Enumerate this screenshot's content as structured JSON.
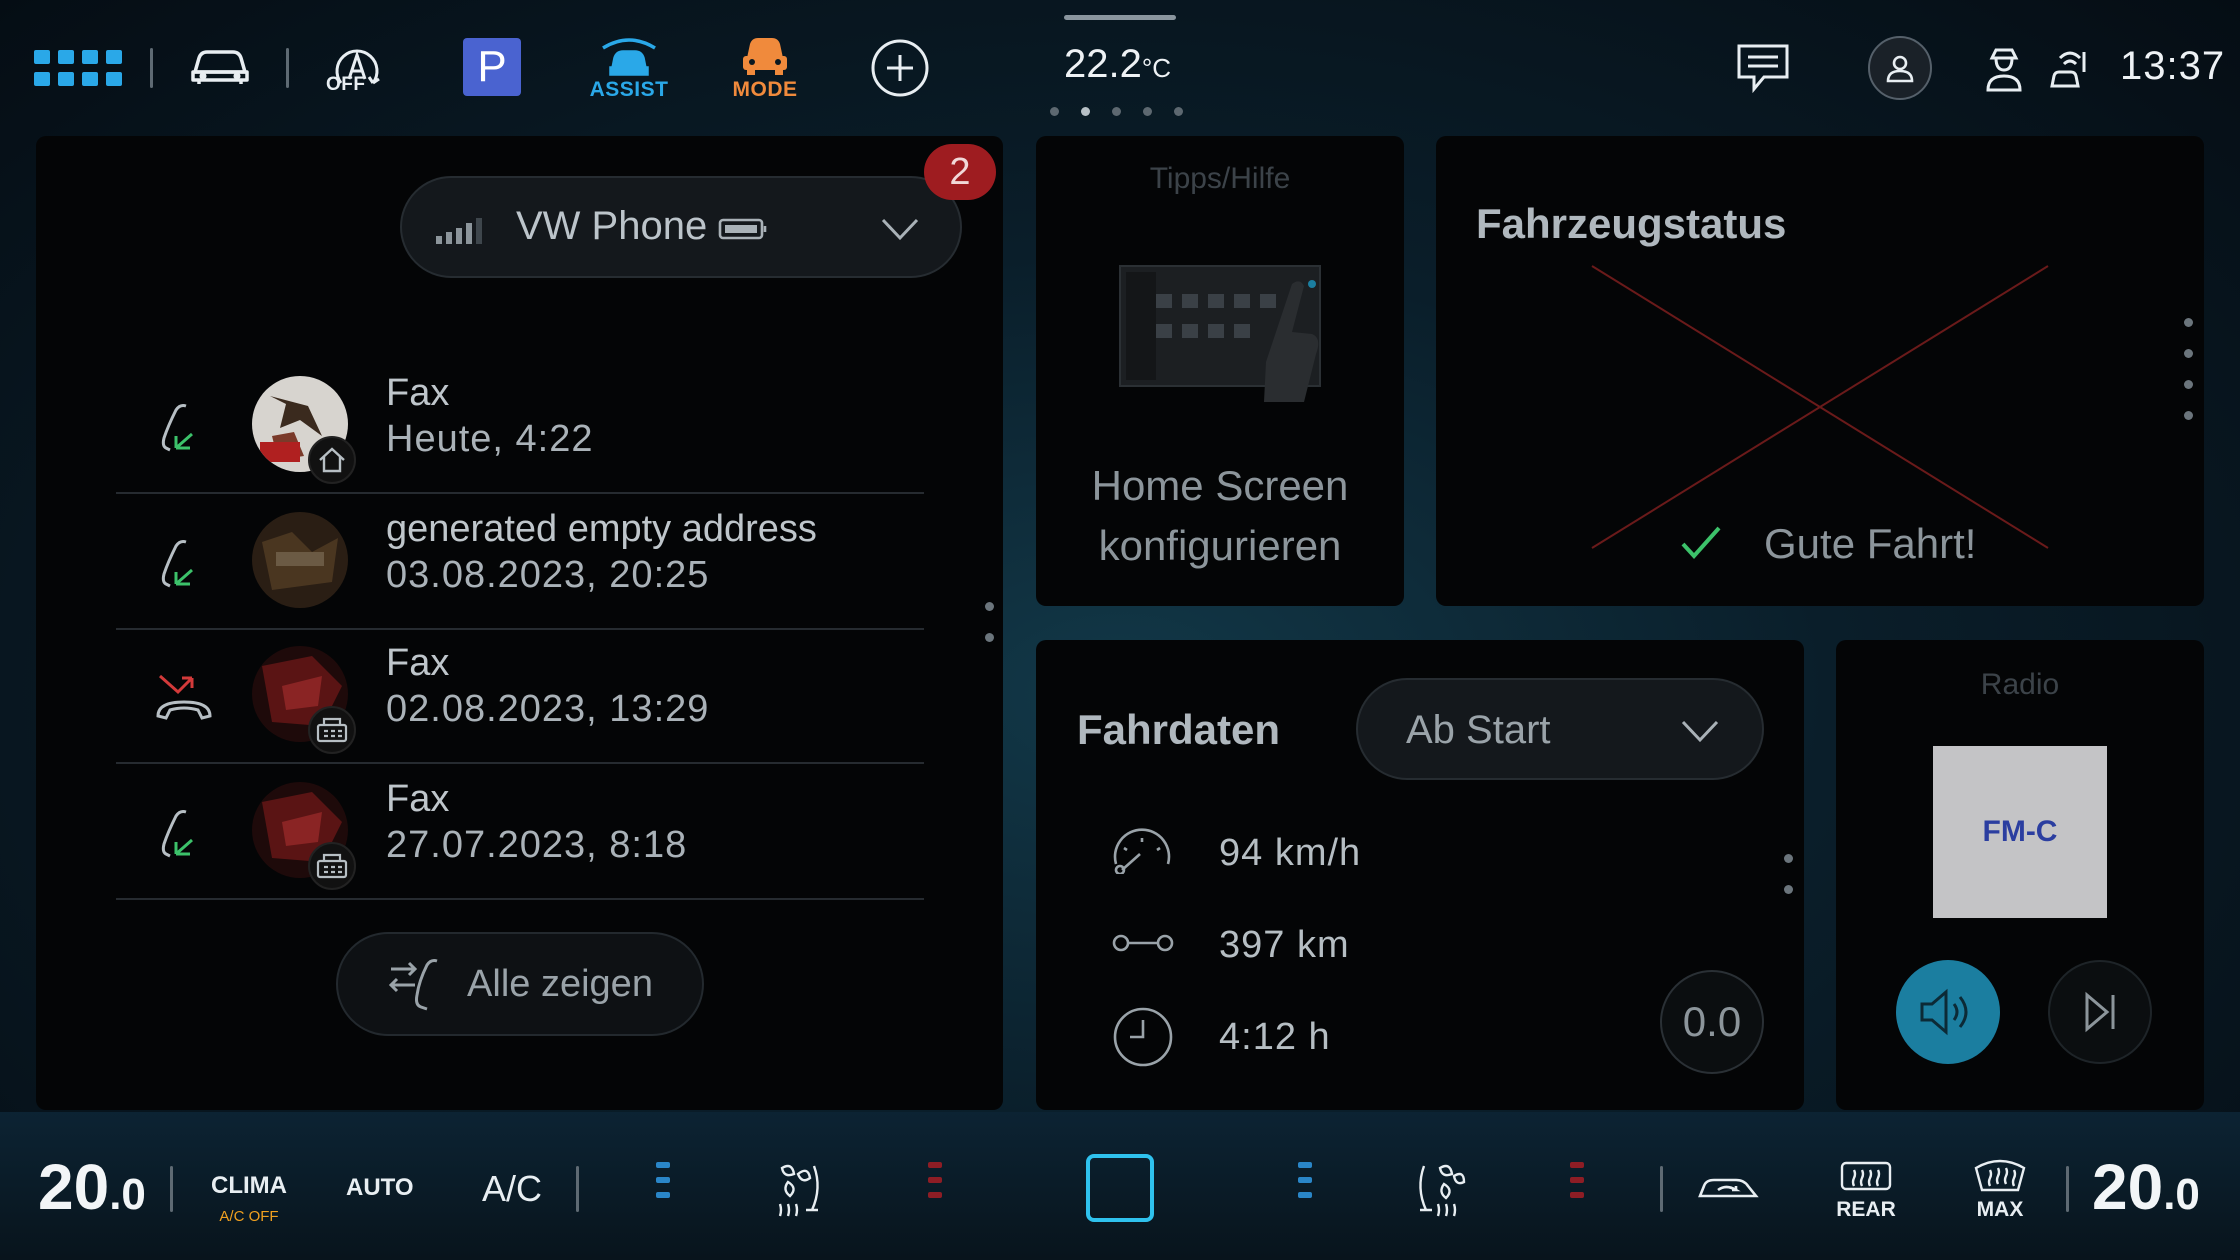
{
  "topbar": {
    "time": "13:37",
    "outside_temp": "22.2",
    "outside_temp_unit": "°C",
    "auto_hold_caption": "OFF",
    "parking_label": "P",
    "assist_label": "ASSIST",
    "mode_label": "MODE",
    "colors": {
      "accent": "#2aa8e8",
      "assist": "#2aa8e8",
      "mode": "#f08a3c",
      "parking": "#4a63d0"
    },
    "icons": [
      "apps-grid-icon",
      "car-icon",
      "auto-hold-icon",
      "parking-icon",
      "assist-icon",
      "mode-icon",
      "add-icon",
      "message-icon",
      "profile-icon",
      "driver-icon",
      "connectivity-icon"
    ]
  },
  "phone": {
    "device_name": "VW Phone",
    "badge_count": "2",
    "calls": [
      {
        "name": "Fax",
        "time": "Heute, 4:22",
        "direction": "incoming",
        "sub_icon": "home-icon"
      },
      {
        "name": "generated empty address",
        "time": "03.08.2023, 20:25",
        "direction": "incoming",
        "sub_icon": ""
      },
      {
        "name": "Fax",
        "time": "02.08.2023, 13:29",
        "direction": "missed",
        "sub_icon": "fax-icon"
      },
      {
        "name": "Fax",
        "time": "27.07.2023, 8:18",
        "direction": "incoming",
        "sub_icon": "fax-icon"
      }
    ],
    "show_all_label": "Alle zeigen"
  },
  "tips": {
    "title": "Tipps/Hilfe",
    "text_line1": "Home Screen",
    "text_line2": "konfigurieren"
  },
  "status": {
    "title": "Fahrzeugstatus",
    "message": "Gute Fahrt!"
  },
  "drive": {
    "title": "Fahrdaten",
    "period": "Ab Start",
    "speed": "94 km/h",
    "distance": "397 km",
    "duration": "4:12 h",
    "reset_value": "0.0"
  },
  "radio": {
    "title": "Radio",
    "station": "FM-C"
  },
  "climate": {
    "left_temp_int": "20",
    "left_temp_dec": ".0",
    "right_temp_int": "20",
    "right_temp_dec": ".0",
    "clima_label": "CLIMA",
    "ac_off_label": "A/C OFF",
    "auto_label": "AUTO",
    "ac_label": "A/C",
    "rear_label": "REAR",
    "max_label": "MAX",
    "colors": {
      "cool": "#2a86c8",
      "heat": "#8e1d25",
      "ac_off": "#f0a020",
      "active": "#2fc2ee"
    }
  }
}
